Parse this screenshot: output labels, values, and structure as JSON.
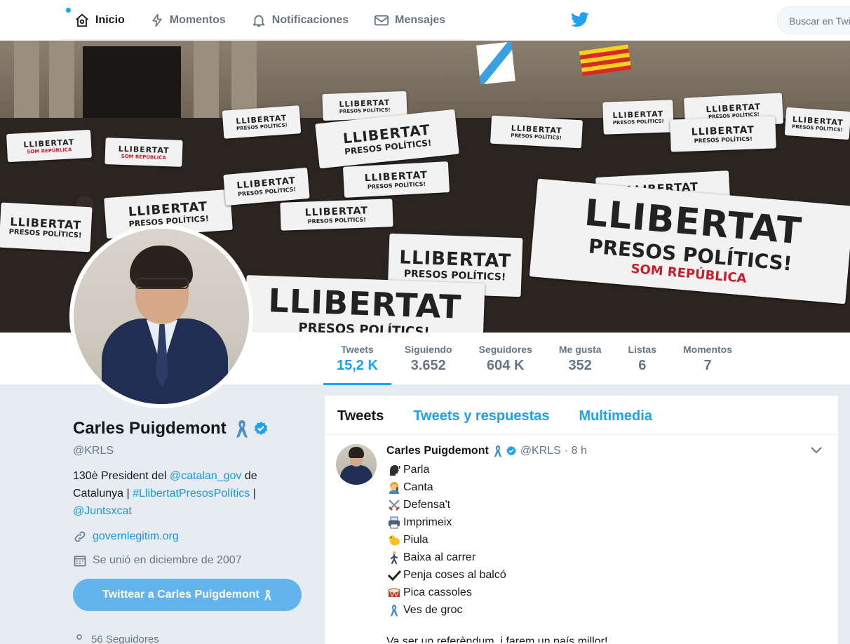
{
  "nav": {
    "items": [
      {
        "label": "Inicio",
        "icon": "home-icon"
      },
      {
        "label": "Momentos",
        "icon": "lightning-icon"
      },
      {
        "label": "Notificaciones",
        "icon": "bell-icon"
      },
      {
        "label": "Mensajes",
        "icon": "envelope-icon"
      }
    ],
    "search_placeholder": "Buscar en Twitter",
    "accent": "#1da1f2"
  },
  "banner": {
    "signs": [
      {
        "line1": "LLIBERTAT",
        "line2": "PRESOS POLÍTICS!",
        "line3": "SOM REPÚBLICA"
      }
    ]
  },
  "stats": [
    {
      "label": "Tweets",
      "value": "15,2 K"
    },
    {
      "label": "Siguiendo",
      "value": "3.652"
    },
    {
      "label": "Seguidores",
      "value": "604 K"
    },
    {
      "label": "Me gusta",
      "value": "352"
    },
    {
      "label": "Listas",
      "value": "6"
    },
    {
      "label": "Momentos",
      "value": "7"
    }
  ],
  "profile": {
    "name": "Carles Puigdemont",
    "handle": "@KRLS",
    "bio_part1": "130è President del ",
    "bio_link1": "@catalan_gov",
    "bio_part2": " de Catalunya | ",
    "bio_link2": "#LlibertatPresosPolítics",
    "bio_part3": " |",
    "bio_link3": "@Juntsxcat",
    "website": "governlegitim.org",
    "joined": "Se unió en diciembre de 2007",
    "tweet_to_button": "Twittear a Carles Puigdemont",
    "below_fold": "56 Seguidores"
  },
  "timeline": {
    "tabs": [
      "Tweets",
      "Tweets y respuestas",
      "Multimedia"
    ],
    "tweet": {
      "name": "Carles Puigdemont",
      "handle": "@KRLS",
      "time": "· 8 h",
      "lines": [
        {
          "emoji": "speaking-head-icon",
          "text": "Parla"
        },
        {
          "emoji": "singer-icon",
          "text": "Canta"
        },
        {
          "emoji": "crossed-swords-icon",
          "text": "Defensa't"
        },
        {
          "emoji": "printer-icon",
          "text": "Imprimeix"
        },
        {
          "emoji": "chick-icon",
          "text": "Piula"
        },
        {
          "emoji": "walking-person-icon",
          "text": "Baixa al carrer"
        },
        {
          "emoji": "check-mark-icon",
          "text": "Penja coses al balcó"
        },
        {
          "emoji": "drum-icon",
          "text": "Pica cassoles"
        },
        {
          "emoji": "ribbon-icon",
          "text": "Ves de groc"
        }
      ],
      "continuation": "Va ser un referèndum, i farem un país millor!"
    }
  }
}
